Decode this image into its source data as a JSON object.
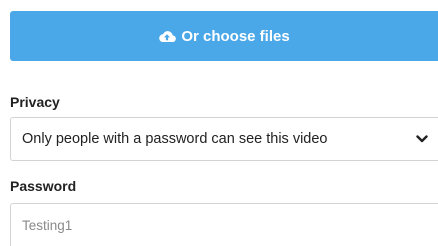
{
  "upload": {
    "button_label": "Or choose files",
    "icon": "cloud-upload-icon",
    "color": "#4aa8e8"
  },
  "privacy": {
    "label": "Privacy",
    "selected": "Only people with a password can see this video",
    "icon": "chevron-down-icon"
  },
  "password": {
    "label": "Password",
    "value": "Testing1"
  }
}
